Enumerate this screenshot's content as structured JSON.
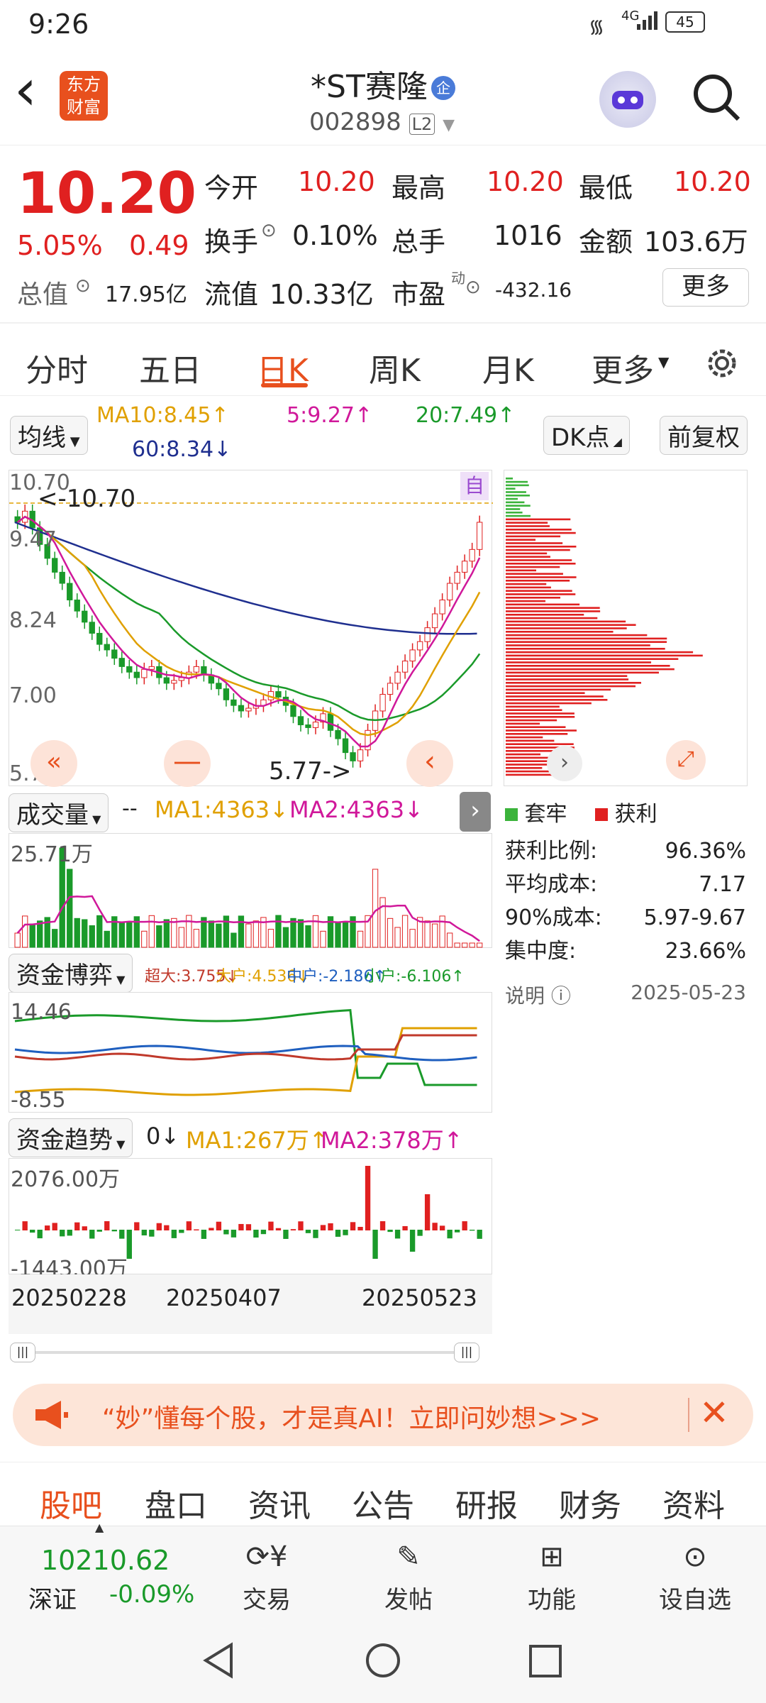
{
  "status": {
    "time": "9:26",
    "battery": "45",
    "net": "4G"
  },
  "header": {
    "back": "‹",
    "logo_line1": "东方",
    "logo_line2": "财富",
    "title": "*ST赛隆",
    "title_badge": "企",
    "code": "002898",
    "level": "L2"
  },
  "quote": {
    "price": "10.20",
    "change_pct": "5.05%",
    "change": "0.49",
    "row1": [
      {
        "k": "今开",
        "v": "10.20"
      },
      {
        "k": "最高",
        "v": "10.20"
      },
      {
        "k": "最低",
        "v": "10.20"
      }
    ],
    "row2": [
      {
        "k": "换手",
        "v": "0.10%"
      },
      {
        "k": "总手",
        "v": "1016"
      },
      {
        "k": "金额",
        "v": "103.6万"
      }
    ],
    "row3": [
      {
        "k": "总值",
        "v": "17.95亿"
      },
      {
        "k": "流值",
        "v": "10.33亿"
      },
      {
        "k": "市盈",
        "v": "-432.16"
      }
    ],
    "pe_sup": "动",
    "more_button": "更多"
  },
  "tabs": [
    "分时",
    "五日",
    "日K",
    "周K",
    "月K",
    "更多"
  ],
  "active_tab": "日K",
  "kline": {
    "ma_select": "均线",
    "ma10": "MA10:8.45↑",
    "ma5": "5:9.27↑",
    "ma20": "20:7.49↑",
    "ma60": "60:8.34↓",
    "dk_button": "DK点",
    "fq_button": "前复权",
    "axis": [
      "10.70",
      "9.47",
      "8.24",
      "7.00",
      "5.77"
    ],
    "high_marker": "<-10.70",
    "low_marker": "5.77->",
    "self_tag": "自",
    "colors": {
      "up": "#e02020",
      "down": "#1a9a2a",
      "ma5": "#d0189a",
      "ma10": "#e0a000",
      "ma20": "#1a9a2a",
      "ma60": "#1f2f8f"
    },
    "closes": [
      10.2,
      10.4,
      10.1,
      9.8,
      9.55,
      9.3,
      9.1,
      8.8,
      8.6,
      8.4,
      8.2,
      8.0,
      7.9,
      7.75,
      7.6,
      7.5,
      7.4,
      7.55,
      7.6,
      7.4,
      7.3,
      7.35,
      7.4,
      7.5,
      7.6,
      7.45,
      7.3,
      7.2,
      7.0,
      6.9,
      6.8,
      6.85,
      6.9,
      7.0,
      7.15,
      7.05,
      6.9,
      6.7,
      6.55,
      6.5,
      6.6,
      6.75,
      6.45,
      6.3,
      6.05,
      5.9,
      6.1,
      6.45,
      6.8,
      7.1,
      7.3,
      7.5,
      7.7,
      7.9,
      8.05,
      8.3,
      8.55,
      8.8,
      9.1,
      9.3,
      9.5,
      9.71,
      10.2
    ]
  },
  "chip": {
    "legend": [
      {
        "name": "套牢",
        "color": "#3bb33b"
      },
      {
        "name": "获利",
        "color": "#e02020"
      }
    ],
    "stats": [
      {
        "k": "获利比例:",
        "v": "96.36%"
      },
      {
        "k": "平均成本:",
        "v": "7.17"
      },
      {
        "k": "90%成本:",
        "v": "5.97-9.67"
      },
      {
        "k": "集中度:",
        "v": "23.66%"
      }
    ],
    "note": "说明",
    "date": "2025-05-23"
  },
  "volume": {
    "select": "成交量",
    "dashes": "--",
    "ma1": "MA1:4363↓",
    "ma2": "MA2:4363↓",
    "axis_top": "25.71万"
  },
  "fund_game": {
    "select": "资金博弈",
    "items": [
      {
        "t": "超大:3.755↓",
        "c": "#c0392b"
      },
      {
        "t": "大户:4.536↓",
        "c": "#e0a000"
      },
      {
        "t": "中户:-2.186↑",
        "c": "#1f5fbf"
      },
      {
        "t": "小户:-6.106↑",
        "c": "#1a9a2a"
      }
    ],
    "axis_top": "14.46",
    "axis_bottom": "-8.55"
  },
  "fund_trend": {
    "select": "资金趋势",
    "val": "0↓",
    "ma1": "MA1:267万↑",
    "ma2": "MA2:378万↑",
    "axis_top": "2076.00万",
    "axis_bottom": "-1443.00万"
  },
  "dates": [
    "20250228",
    "20250407",
    "20250523"
  ],
  "banner": {
    "text": "“妙”懂每个股，才是真AI！立即问妙想>>>"
  },
  "bottom_tabs": [
    "股吧",
    "盘口",
    "资讯",
    "公告",
    "研报",
    "财务",
    "资料"
  ],
  "index": {
    "value": "10210.62",
    "name": "深证",
    "change": "-0.09%"
  },
  "toolbar": [
    "交易",
    "发帖",
    "功能",
    "设自选"
  ]
}
